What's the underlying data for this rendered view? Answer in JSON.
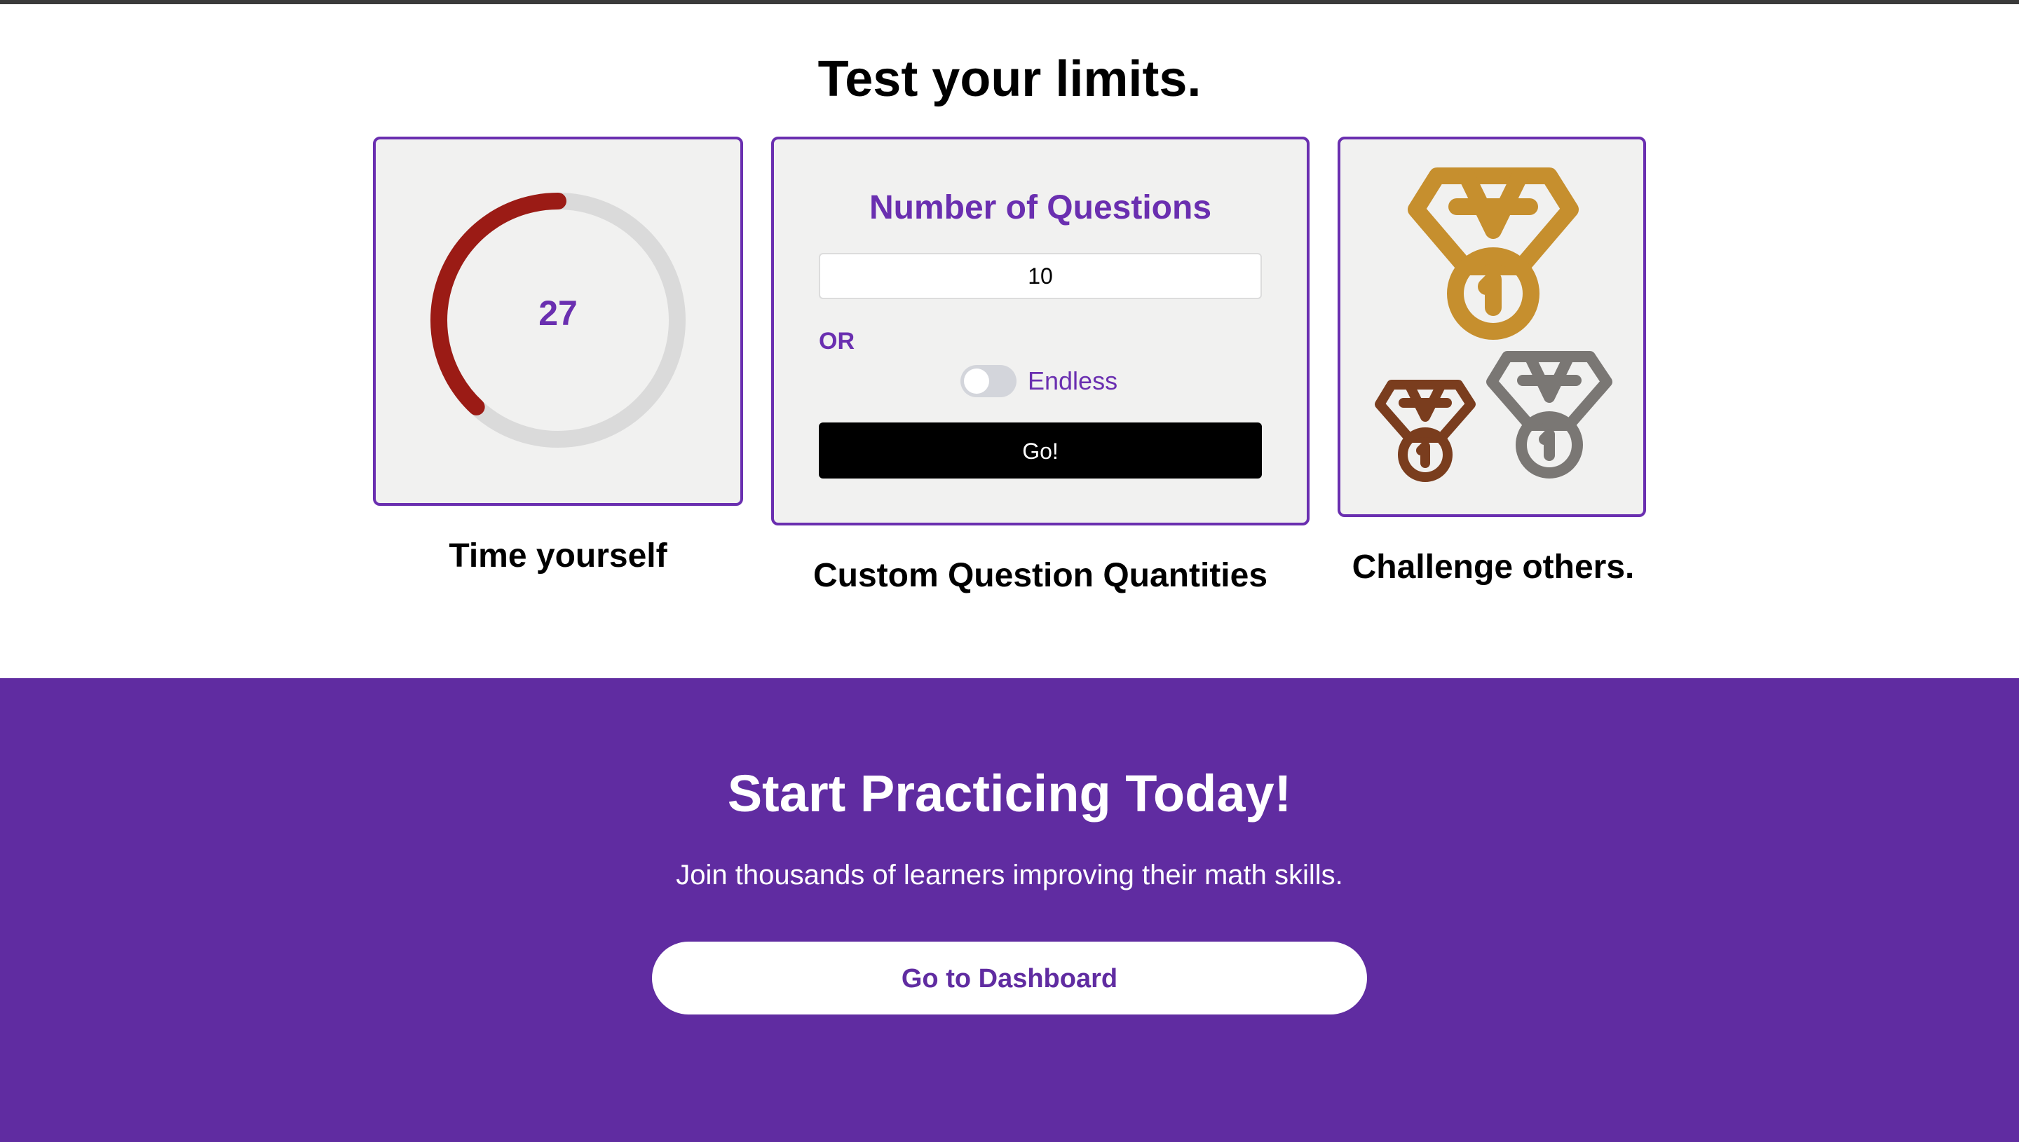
{
  "features": {
    "title": "Test your limits.",
    "timer": {
      "value": "27",
      "progress_fraction": 0.38,
      "caption": "Time yourself",
      "arc_color": "#9b1b15",
      "track_color": "#dadada"
    },
    "questions": {
      "heading": "Number of Questions",
      "input_value": "10",
      "or_label": "OR",
      "toggle_label": "Endless",
      "toggle_on": false,
      "go_label": "Go!",
      "caption": "Custom Question Quantities"
    },
    "challenge": {
      "caption": "Challenge others.",
      "medals": [
        {
          "icon": "gold-medal-icon",
          "color": "#c68f2e"
        },
        {
          "icon": "bronze-medal-icon",
          "color": "#7a3d1e"
        },
        {
          "icon": "silver-medal-icon",
          "color": "#7a7774"
        }
      ]
    }
  },
  "cta": {
    "title": "Start Practicing Today!",
    "subtitle": "Join thousands of learners improving their math skills.",
    "button_label": "Go to Dashboard"
  },
  "colors": {
    "accent": "#6a2fb0",
    "cta_background": "#602ca1"
  }
}
